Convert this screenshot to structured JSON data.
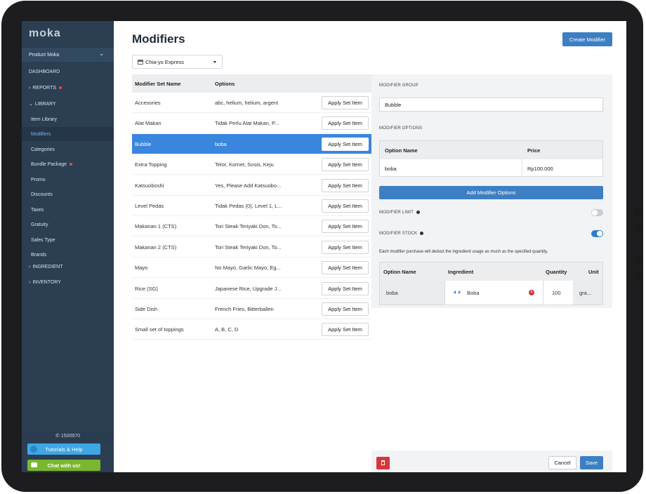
{
  "sidebar": {
    "logo": "moka",
    "account": "Product Moka",
    "items": [
      {
        "label": "DASHBOARD"
      },
      {
        "label": "REPORTS"
      },
      {
        "label": "LIBRARY"
      },
      {
        "label": "Item Library"
      },
      {
        "label": "Modifiers"
      },
      {
        "label": "Categories"
      },
      {
        "label": "Bundle Package"
      },
      {
        "label": "Promo"
      },
      {
        "label": "Discounts"
      },
      {
        "label": "Taxes"
      },
      {
        "label": "Gratuity"
      },
      {
        "label": "Sales Type"
      },
      {
        "label": "Brands"
      },
      {
        "label": "INGREDIENT"
      },
      {
        "label": "INVENTORY"
      }
    ],
    "phone": "1500970",
    "tutorials": "Tutorials & Help",
    "chat": "Chat with us!"
  },
  "header": {
    "title": "Modifiers",
    "create_button": "Create Modifier",
    "outlet": "Chia-yo Express"
  },
  "table": {
    "col_name": "Modifier Set Name",
    "col_options": "Options",
    "apply_label": "Apply Set Item",
    "rows": [
      {
        "name": "Accesories",
        "options": "abc, helium, helium, argent"
      },
      {
        "name": "Alat Makan",
        "options": "Tidak Perlu Alat Makan, P..."
      },
      {
        "name": "Bubble",
        "options": "boba"
      },
      {
        "name": "Extra Topping",
        "options": "Telor, Kornet, Sosis, Keju"
      },
      {
        "name": "Katsuoboshi",
        "options": "Yes, Please Add Katsuobo..."
      },
      {
        "name": "Level Pedas",
        "options": "Tidak Pedas (0), Level 1, L..."
      },
      {
        "name": "Makanan 1 (CTS)",
        "options": "Tori Steak Teriyaki Don, To..."
      },
      {
        "name": "Makanan 2 (CTS)",
        "options": "Tori Steak Teriyaki Don, To..."
      },
      {
        "name": "Mayo",
        "options": "No Mayo, Garlic Mayo, Eg..."
      },
      {
        "name": "Rice (SG)",
        "options": "Japanese Rice, Upgrade J..."
      },
      {
        "name": "Side Dish",
        "options": "French Fries, Bitterballen"
      },
      {
        "name": "Small set of toppings",
        "options": "A, B, C, D"
      }
    ]
  },
  "panel": {
    "group_label": "MODIFIER GROUP",
    "group_value": "Bubble",
    "options_label": "MODIFIER OPTIONS",
    "opt_col_name": "Option Name",
    "opt_col_price": "Price",
    "opt_name": "boba",
    "opt_price": "Rp100.000",
    "add_options": "Add Modifier Options",
    "limit_label": "MODIFIER LIMIT",
    "limit_on": false,
    "stock_label": "MODIFIER STOCK",
    "stock_on": true,
    "description": "Each modifier purchase will deduct the ingredient usage as much as the specified quantity.",
    "ing_col_option": "Option Name",
    "ing_col_ingredient": "Ingredient",
    "ing_col_quantity": "Quantity",
    "ing_col_unit": "Unit",
    "ing_option": "boba",
    "ing_ingredient": "Boba",
    "ing_quantity": "100",
    "ing_unit": "gra..."
  },
  "footer": {
    "cancel": "Cancel",
    "save": "Save"
  },
  "colors": {
    "sidebar": "#2b3e52",
    "accent": "#3d7fc3",
    "selected_row": "#3a86de",
    "danger": "#d9363e"
  }
}
